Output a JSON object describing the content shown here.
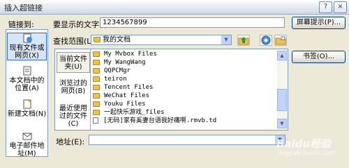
{
  "window": {
    "title": "插入超链接"
  },
  "titlebar": {
    "help_icon": "?",
    "close_icon": "×"
  },
  "link_to": {
    "label": "链接到:"
  },
  "display_text": {
    "label": "要显示的文字(I):",
    "value": "1234567899"
  },
  "screen_tip": {
    "label": "屏幕提示(P)..."
  },
  "look_in": {
    "label": "查找范围(L):",
    "value": "我的文档"
  },
  "sidebar": {
    "items": [
      {
        "label": "现有文件或网页(X)"
      },
      {
        "label": "本文档中的位置(A)"
      },
      {
        "label": "新建文档(N)"
      },
      {
        "label": "电子邮件地址(M)"
      }
    ]
  },
  "nav": {
    "items": [
      {
        "label": "当前文件夹(U)"
      },
      {
        "label": "浏览过的网页(B)"
      },
      {
        "label": "最近使用过的文件(C)"
      }
    ]
  },
  "files": [
    {
      "name": "My Mvbox Files",
      "type": "folder"
    },
    {
      "name": "My WangWang",
      "type": "folder"
    },
    {
      "name": "QQPCMgr",
      "type": "folder"
    },
    {
      "name": "teiron",
      "type": "folder"
    },
    {
      "name": "Tencent Files",
      "type": "folder"
    },
    {
      "name": "WeChat Files",
      "type": "folder"
    },
    {
      "name": "Youku Files",
      "type": "folder"
    },
    {
      "name": "一起快乐游戏_files",
      "type": "folder"
    },
    {
      "name": "[无码]家有奚妻台语我好痛啊.rmvb.td",
      "type": "file"
    }
  ],
  "bookmark": {
    "label": "书签(O)..."
  },
  "address": {
    "label": "地址(E):",
    "value": ""
  },
  "watermark": {
    "text": "Baidu经验",
    "sub": "jingyan.baidu.com"
  }
}
